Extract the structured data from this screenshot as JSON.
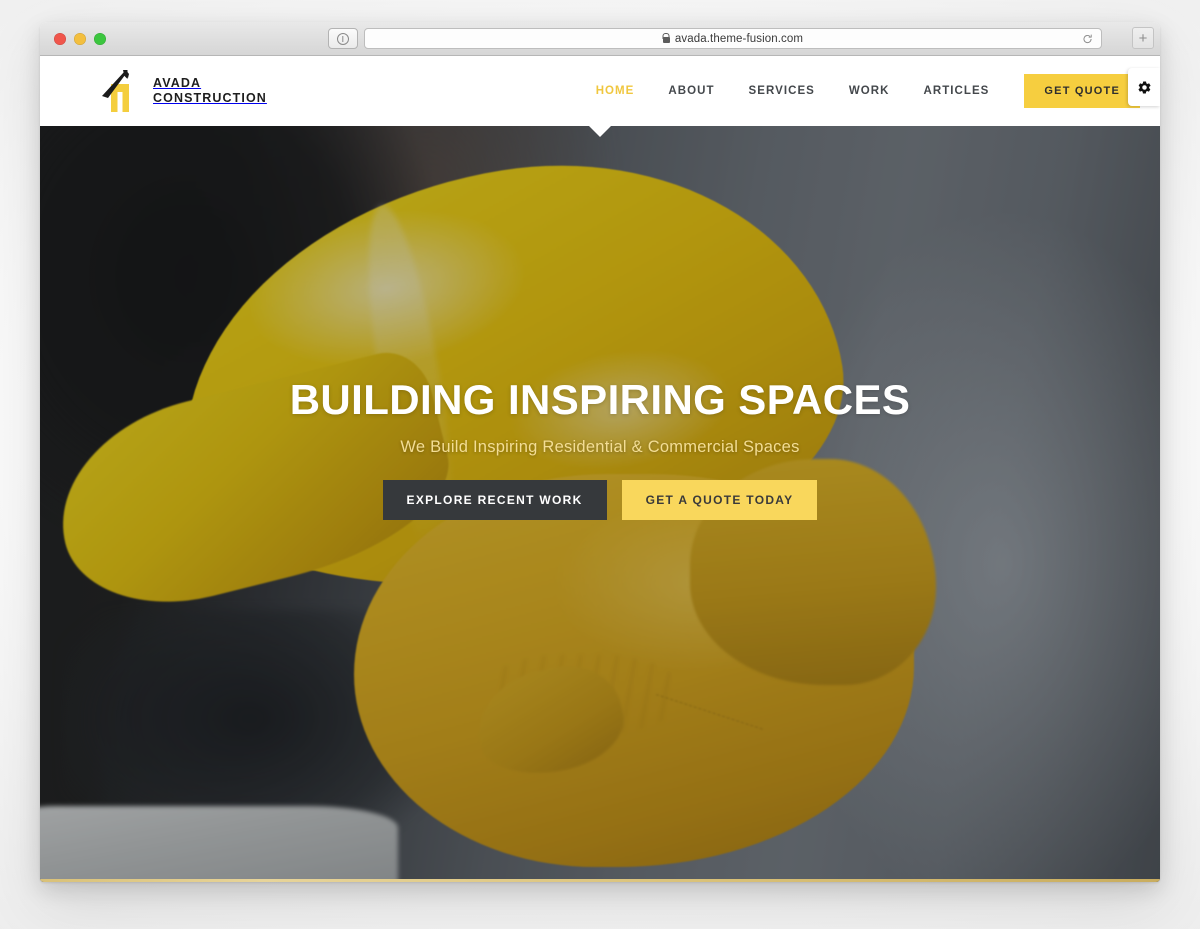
{
  "browser": {
    "url": "avada.theme-fusion.com",
    "lock_icon": "lock-icon",
    "reload_icon": "reload-icon",
    "shield_icon": "shield-icon",
    "new_tab_label": "+",
    "traffic_lights": [
      "close",
      "minimize",
      "maximize"
    ]
  },
  "site": {
    "brand": {
      "line1": "AVADA",
      "line2": "CONSTRUCTION",
      "mark_icon": "house-logo-icon"
    },
    "nav": [
      {
        "label": "HOME",
        "active": true
      },
      {
        "label": "ABOUT",
        "active": false
      },
      {
        "label": "SERVICES",
        "active": false
      },
      {
        "label": "WORK",
        "active": false
      },
      {
        "label": "ARTICLES",
        "active": false
      }
    ],
    "quote_button": "GET QUOTE",
    "hero": {
      "title": "BUILDING INSPIRING SPACES",
      "subtitle": "We Build Inspiring Residential & Commercial Spaces",
      "primary_button": "EXPLORE RECENT WORK",
      "secondary_button": "GET A QUOTE TODAY"
    },
    "gear_tab_icon": "gear-icon"
  },
  "colors": {
    "brand_yellow": "#f6ce3f",
    "hero_button_yellow": "#f9d75c",
    "hero_button_dark": "#36393c",
    "nav_active": "#f0c73f",
    "subtitle_yellow": "#f3dd95",
    "text_dark": "#1e1e1e"
  }
}
